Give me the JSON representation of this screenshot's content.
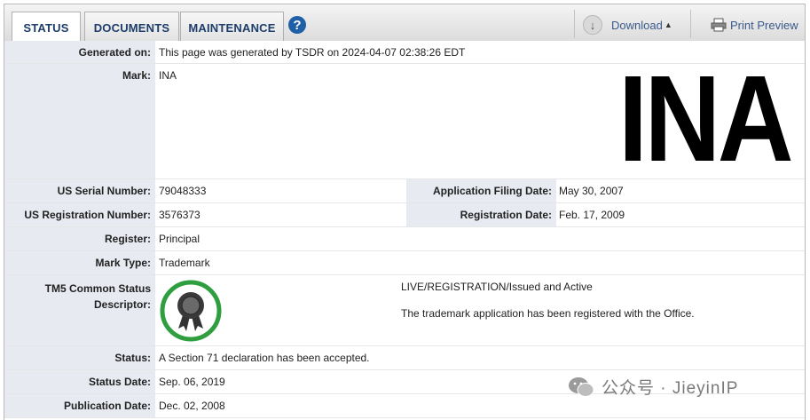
{
  "tabs": [
    {
      "label": "STATUS",
      "active": true
    },
    {
      "label": "DOCUMENTS",
      "active": false
    },
    {
      "label": "MAINTENANCE",
      "active": false
    }
  ],
  "toolbar": {
    "help_label": "?",
    "download_label": "Download",
    "print_label": "Print Preview"
  },
  "record": {
    "generated_on_label": "Generated on:",
    "generated_on_value": "This page was generated by TSDR on 2024-04-07 02:38:26 EDT",
    "mark_label": "Mark:",
    "mark_value": "INA",
    "mark_image_text": "INA",
    "serial_label": "US Serial Number:",
    "serial_value": "79048333",
    "filing_date_label": "Application Filing Date:",
    "filing_date_value": "May 30, 2007",
    "registration_label": "US Registration Number:",
    "registration_value": "3576373",
    "registration_date_label": "Registration Date:",
    "registration_date_value": "Feb. 17, 2009",
    "register_label": "Register:",
    "register_value": "Principal",
    "mark_type_label": "Mark Type:",
    "mark_type_value": "Trademark",
    "tm5_label_line1": "TM5 Common Status",
    "tm5_label_line2": "Descriptor:",
    "tm5_status": "LIVE/REGISTRATION/Issued and Active",
    "tm5_description": "The trademark application has been registered with the Office.",
    "status_label": "Status:",
    "status_value": "A Section 71 declaration has been accepted.",
    "status_date_label": "Status Date:",
    "status_date_value": "Sep. 06, 2019",
    "publication_date_label": "Publication Date:",
    "publication_date_value": "Dec. 02, 2008"
  },
  "watermark": {
    "text": "公众号 · JieyinIP"
  },
  "colors": {
    "tab_text": "#1d3d6b",
    "label_bg": "#e8eaf2",
    "badge_green": "#2e9e3e",
    "help_blue": "#1f5fa8"
  }
}
